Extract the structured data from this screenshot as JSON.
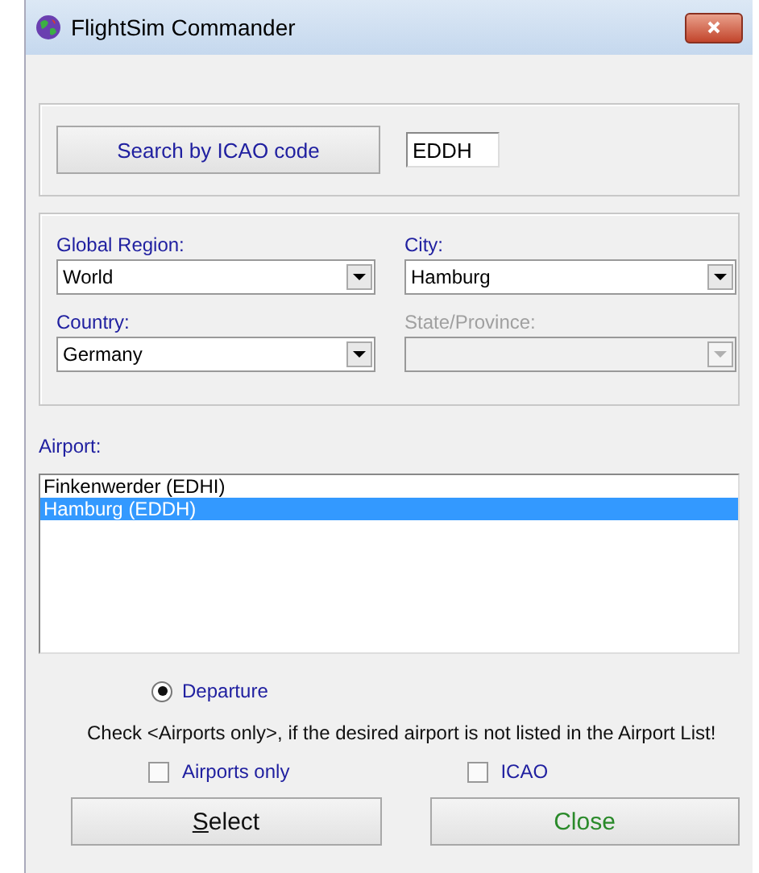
{
  "window": {
    "title": "FlightSim Commander"
  },
  "search": {
    "button": "Search by ICAO code",
    "value": "EDDH"
  },
  "selectors": [
    {
      "label": "Global Region:",
      "value": "World",
      "disabled": false
    },
    {
      "label": "City:",
      "value": "Hamburg",
      "disabled": false
    },
    {
      "label": "Country:",
      "value": "Germany",
      "disabled": false
    },
    {
      "label": "State/Province:",
      "disabled": true
    }
  ],
  "airport": {
    "label": "Airport:",
    "items": [
      {
        "name": "Finkenwerder (EDHI)",
        "selected": false
      },
      {
        "name": "Hamburg (EDDH)",
        "selected": true
      }
    ]
  },
  "direction": {
    "label": "Departure",
    "selected": true
  },
  "hint": "Check <Airports only>, if the desired airport is not listed in the Airport List!",
  "checkboxes": [
    {
      "label": "Airports only",
      "checked": false
    },
    {
      "label": "ICAO",
      "checked": false
    }
  ],
  "buttons": [
    {
      "label": "Select",
      "kind": "default",
      "underline_first": true
    },
    {
      "label": "Close",
      "kind": "green",
      "underline_first": false
    }
  ]
}
